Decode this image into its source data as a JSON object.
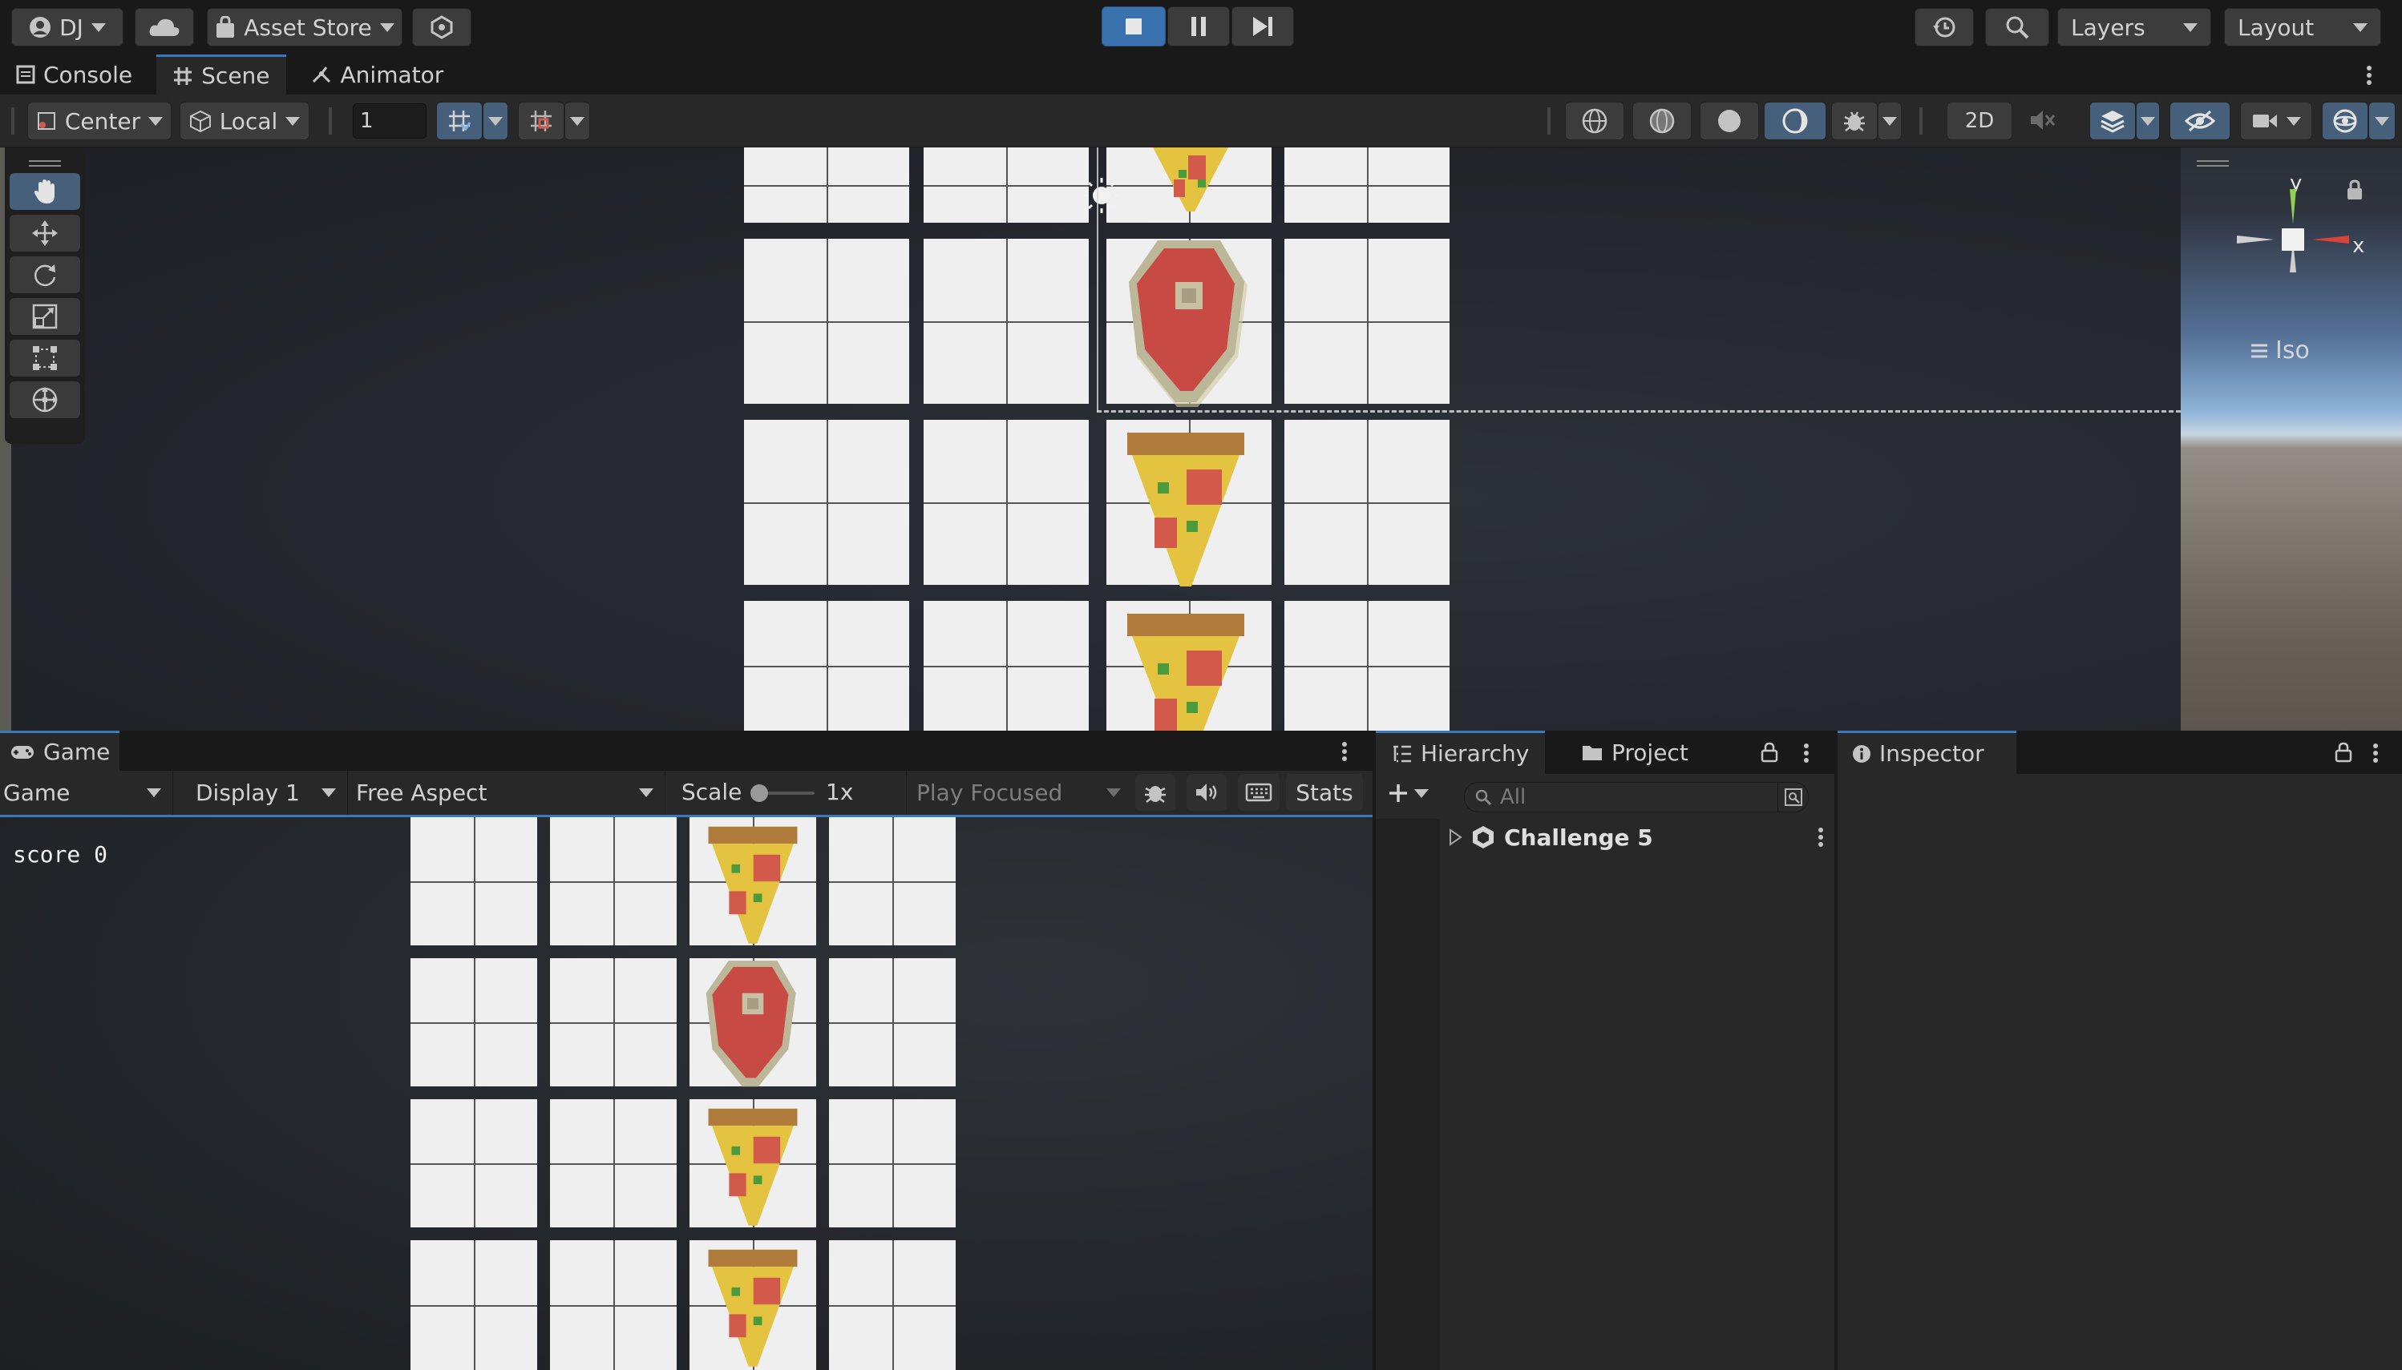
{
  "topbar": {
    "account_label": "DJ",
    "asset_store_label": "Asset Store",
    "layers_label": "Layers",
    "layout_label": "Layout",
    "icons": [
      "account-icon",
      "cloud-icon",
      "asset-store-bag-icon",
      "package-icon",
      "play-icon",
      "pause-icon",
      "step-icon",
      "history-icon",
      "search-icon"
    ],
    "play_active_color": "#3a72b0"
  },
  "scene_tabs": [
    {
      "label": "Console",
      "icon": "console-icon"
    },
    {
      "label": "Scene",
      "icon": "scene-grid-icon"
    },
    {
      "label": "Animator",
      "icon": "animator-icon"
    }
  ],
  "scene_toolbar": {
    "pivot_label": "Center",
    "space_label": "Local",
    "grid_value": "1",
    "mode_2d_label": "2D"
  },
  "scene_tools": [
    "hand-tool-icon",
    "move-tool-icon",
    "rotate-tool-icon",
    "scale-tool-icon",
    "rect-tool-icon",
    "transform-tool-icon"
  ],
  "gizmo": {
    "y_label": "y",
    "x_label": "x",
    "projection_label": "Iso"
  },
  "game": {
    "tab_label": "Game",
    "view_select": "Game",
    "display_select": "Display 1",
    "aspect_select": "Free Aspect",
    "scale_label": "Scale",
    "scale_value": "1x",
    "play_focus_select": "Play Focused",
    "stats_label": "Stats",
    "score_text": "score 0"
  },
  "hierarchy": {
    "tab_label": "Hierarchy",
    "project_tab_label": "Project",
    "search_placeholder": "All",
    "root_item": "Challenge 5"
  },
  "inspector": {
    "tab_label": "Inspector"
  },
  "colors": {
    "accent_blue": "#3a79bb",
    "tile": "#efefef",
    "shield_red": "#c84a45",
    "pizza_yellow": "#e4c341",
    "crust_brown": "#b07c3c"
  }
}
